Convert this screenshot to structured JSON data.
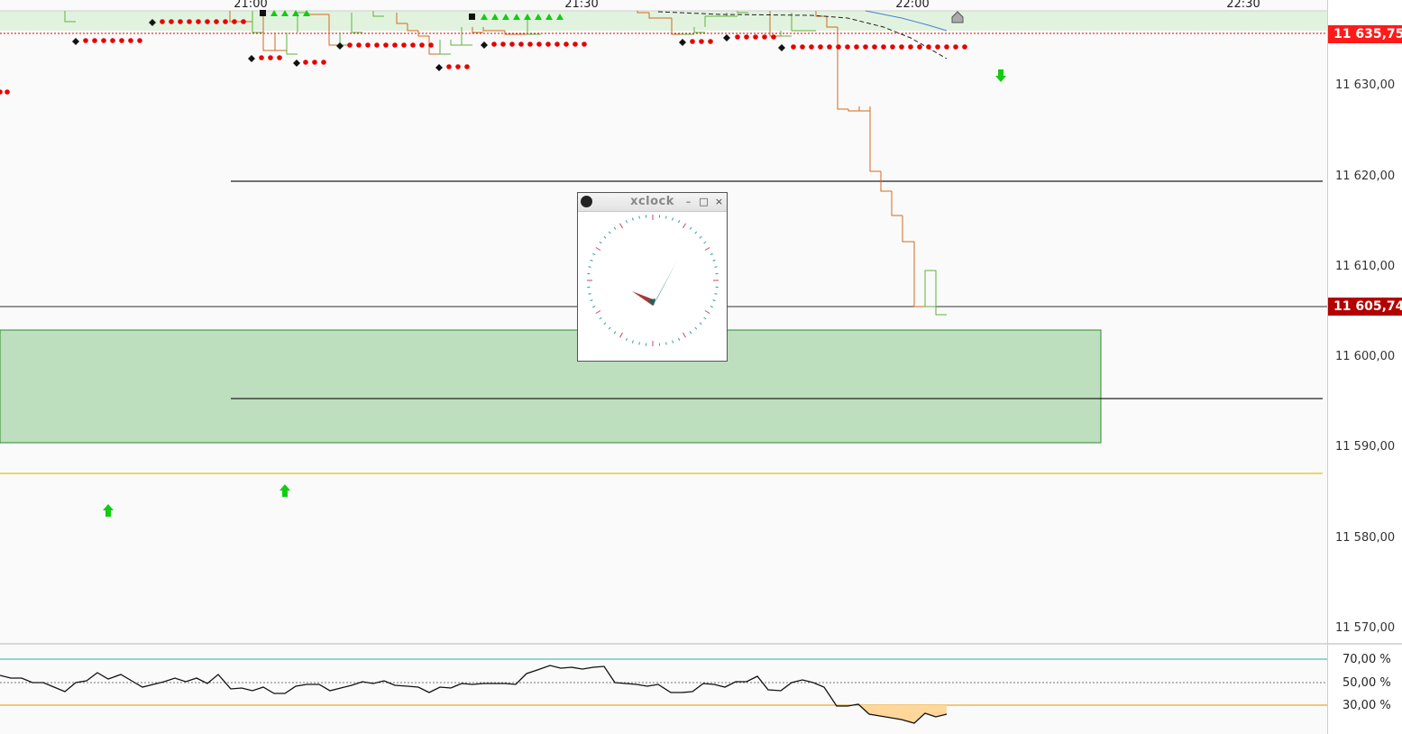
{
  "chart": {
    "time_axis": [
      "21:00",
      "21:30",
      "22:00",
      "22:30"
    ],
    "price_axis": [
      "11 630,00",
      "11 620,00",
      "11 610,00",
      "11 600,00",
      "11 590,00",
      "11 580,00",
      "11 570,00"
    ],
    "flags": {
      "top_price": "11 635,75",
      "current_price": "11 605,74"
    },
    "oscillator_levels": [
      "70,00 %",
      "50,00 %",
      "30,00 %"
    ],
    "colors": {
      "up_candle": "#5fb33a",
      "down_candle": "#d2691e",
      "zone_fill": "#bddfbd",
      "zone_border": "#2e8b2e",
      "signal_dot": "#e60000",
      "arrow": "#11cc11",
      "flag_top": "#ff1a1a",
      "flag_current": "#b30000",
      "osc_upper": "#1fb5a0",
      "osc_lower": "#e59400",
      "osc_fill": "#ffd79a",
      "yellow_line": "#e6c200"
    }
  },
  "xclock": {
    "title": "xclock",
    "hour_hand_color": "#a83a3a",
    "minute_hand_color": "#2e8b8b",
    "tick_color_major": "#d04060",
    "tick_color_minor": "#2e9b9b"
  },
  "icons": {
    "app_icon": "xclock-icon",
    "minimize": "minimize-icon",
    "maximize": "maximize-icon",
    "close": "close-icon"
  }
}
